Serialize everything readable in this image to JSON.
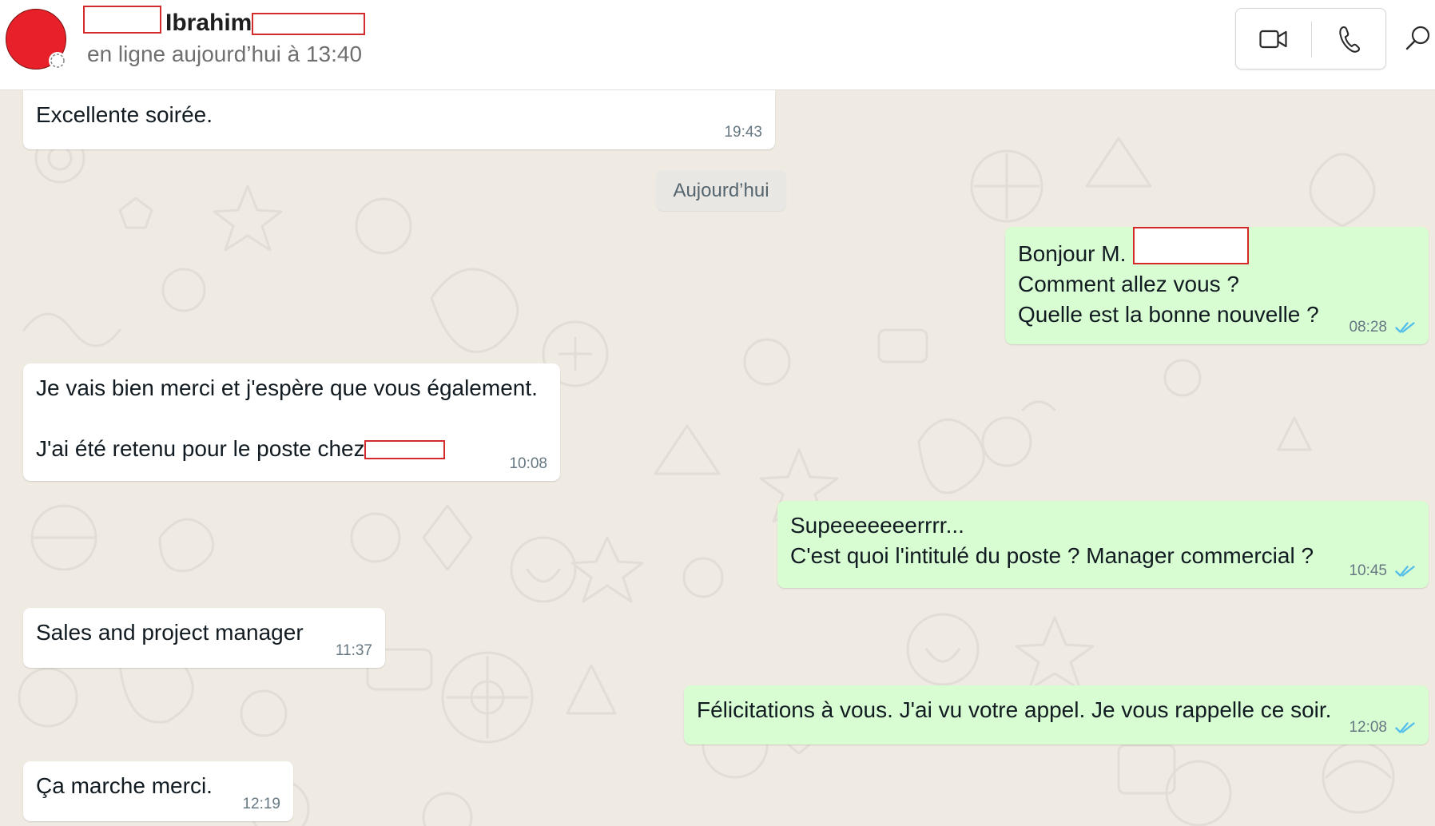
{
  "header": {
    "contact_name": "Ibrahim",
    "status": "en ligne aujourd’hui à 13:40",
    "icons": {
      "video": "video-camera-icon",
      "phone": "phone-icon",
      "search": "search-icon",
      "avatar_status": "status-ring-icon"
    }
  },
  "chat": {
    "date_separator": "Aujourd’hui",
    "messages": [
      {
        "direction": "incoming",
        "text": "Excellente soirée.",
        "time": "19:43"
      },
      {
        "direction": "outgoing",
        "text": "Bonjour M. \nComment allez vous ?\nQuelle est la bonne nouvelle ?",
        "time": "08:28",
        "status": "read"
      },
      {
        "direction": "incoming",
        "text": "Je vais bien merci et j'espère que vous également.\n\nJ'ai été retenu pour le poste chez",
        "time": "10:08"
      },
      {
        "direction": "outgoing",
        "text": "Supeeeeeeerrrr...\nC'est quoi l'intitulé du poste ? Manager commercial ?",
        "time": "10:45",
        "status": "read"
      },
      {
        "direction": "incoming",
        "text": "Sales and project manager",
        "time": "11:37"
      },
      {
        "direction": "outgoing",
        "text": "Félicitations à vous. J'ai vu votre appel. Je vous rappelle ce soir.",
        "time": "12:08",
        "status": "read"
      },
      {
        "direction": "incoming",
        "text": "Ça marche merci.",
        "time": "12:19"
      }
    ]
  },
  "colors": {
    "outgoing_bubble": "#d9fdd3",
    "incoming_bubble": "#ffffff",
    "chat_background": "#efeae2",
    "read_ticks": "#53bdeb",
    "redaction": "#d42a2a",
    "avatar": "#e8202a"
  }
}
